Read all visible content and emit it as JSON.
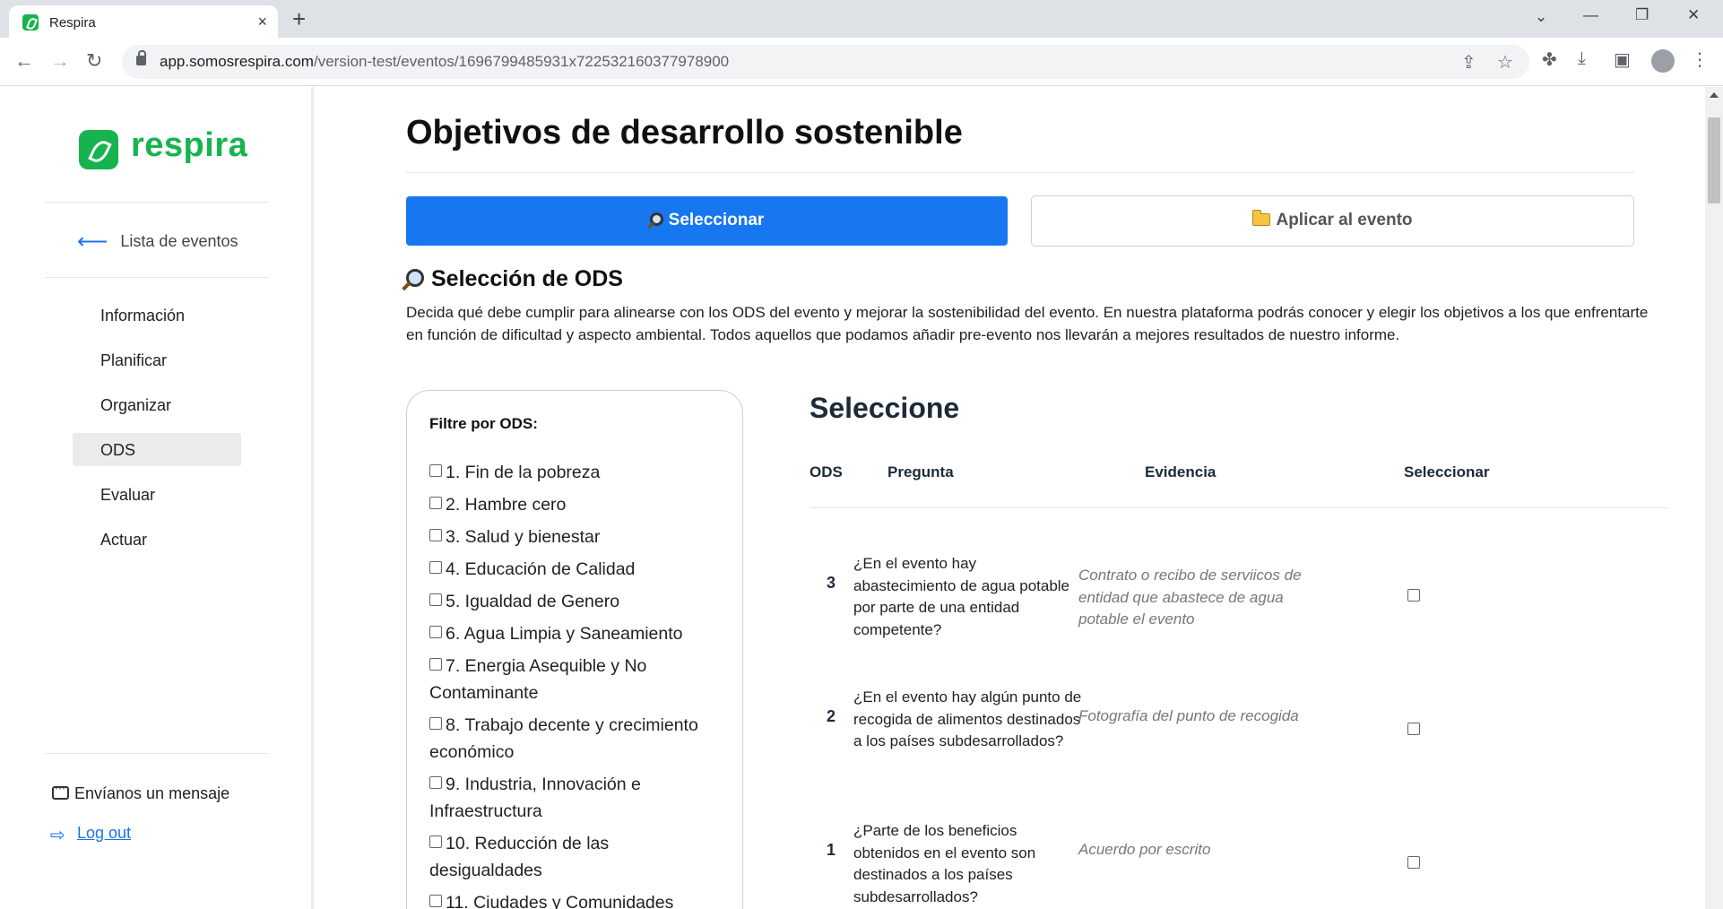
{
  "browser": {
    "tab_title": "Respira",
    "tab_close": "×",
    "new_tab": "+",
    "win_min": "—",
    "win_restore": "❐",
    "win_close": "✕",
    "win_tabsearch": "⌄",
    "url_host": "app.somosrespira.com",
    "url_path": "/version-test/eventos/1696799485931x722532160377978900",
    "icons": [
      "back-arrow-icon",
      "forward-arrow-icon",
      "reload-icon",
      "lock-icon",
      "share-icon",
      "star-icon",
      "extensions-icon",
      "download-icon",
      "side-panel-icon",
      "profile-icon",
      "menu-icon"
    ]
  },
  "sidebar": {
    "logo_text": "respira",
    "brand_color": "#17b34f",
    "back_link": "Lista de eventos",
    "items": [
      {
        "label": "Información",
        "active": false
      },
      {
        "label": "Planificar",
        "active": false
      },
      {
        "label": "Organizar",
        "active": false
      },
      {
        "label": "ODS",
        "active": true
      },
      {
        "label": "Evaluar",
        "active": false
      },
      {
        "label": "Actuar",
        "active": false
      }
    ],
    "message_link": "Envíanos un mensaje",
    "logout_link": "Log out"
  },
  "main": {
    "title": "Objetivos de desarrollo sostenible",
    "btn_select": "Seleccionar",
    "btn_apply": "Aplicar al evento",
    "accent_color": "#1677f0",
    "section_title": "Selección de ODS",
    "intro": "Decida qué debe cumplir para alinearse con los ODS del evento y mejorar la sostenibilidad del evento. En nuestra plataforma podrás conocer y elegir los objetivos a los que enfrentarte en función de dificultad y aspecto ambiental. Todos aquellos que podamos añadir pre-evento nos llevarán a mejores resultados de nuestro informe."
  },
  "filter": {
    "title": "Filtre por ODS:",
    "items": [
      "1. Fin de la pobreza",
      "2. Hambre cero",
      "3. Salud y bienestar",
      "4. Educación de Calidad",
      "5. Igualdad de Genero",
      "6. Agua Limpia y Saneamiento",
      "7. Energia Asequible y No Contaminante",
      "8. Trabajo decente y crecimiento económico",
      "9. Industria, Innovación e Infraestructura",
      "10. Reducción de las desigualdades",
      "11. Ciudades y Comunidades"
    ]
  },
  "table": {
    "title": "Seleccione",
    "headers": {
      "ods": "ODS",
      "question": "Pregunta",
      "evidence": "Evidencia",
      "select": "Seleccionar"
    },
    "rows": [
      {
        "ods": "3",
        "question": "¿En el evento hay abastecimiento de agua potable por parte de una entidad competente?",
        "evidence": "Contrato o recibo de serviicos de entidad que abastece de agua potable el evento",
        "selected": false
      },
      {
        "ods": "2",
        "question": "¿En el evento hay algún punto de recogida de alimentos destinados a los países subdesarrollados?",
        "evidence": "Fotografía del punto de recogida",
        "selected": false
      },
      {
        "ods": "1",
        "question": "¿Parte de los beneficios obtenidos en el evento son destinados a los países subdesarrollados?",
        "evidence": "Acuerdo por escrito",
        "selected": false
      }
    ]
  }
}
